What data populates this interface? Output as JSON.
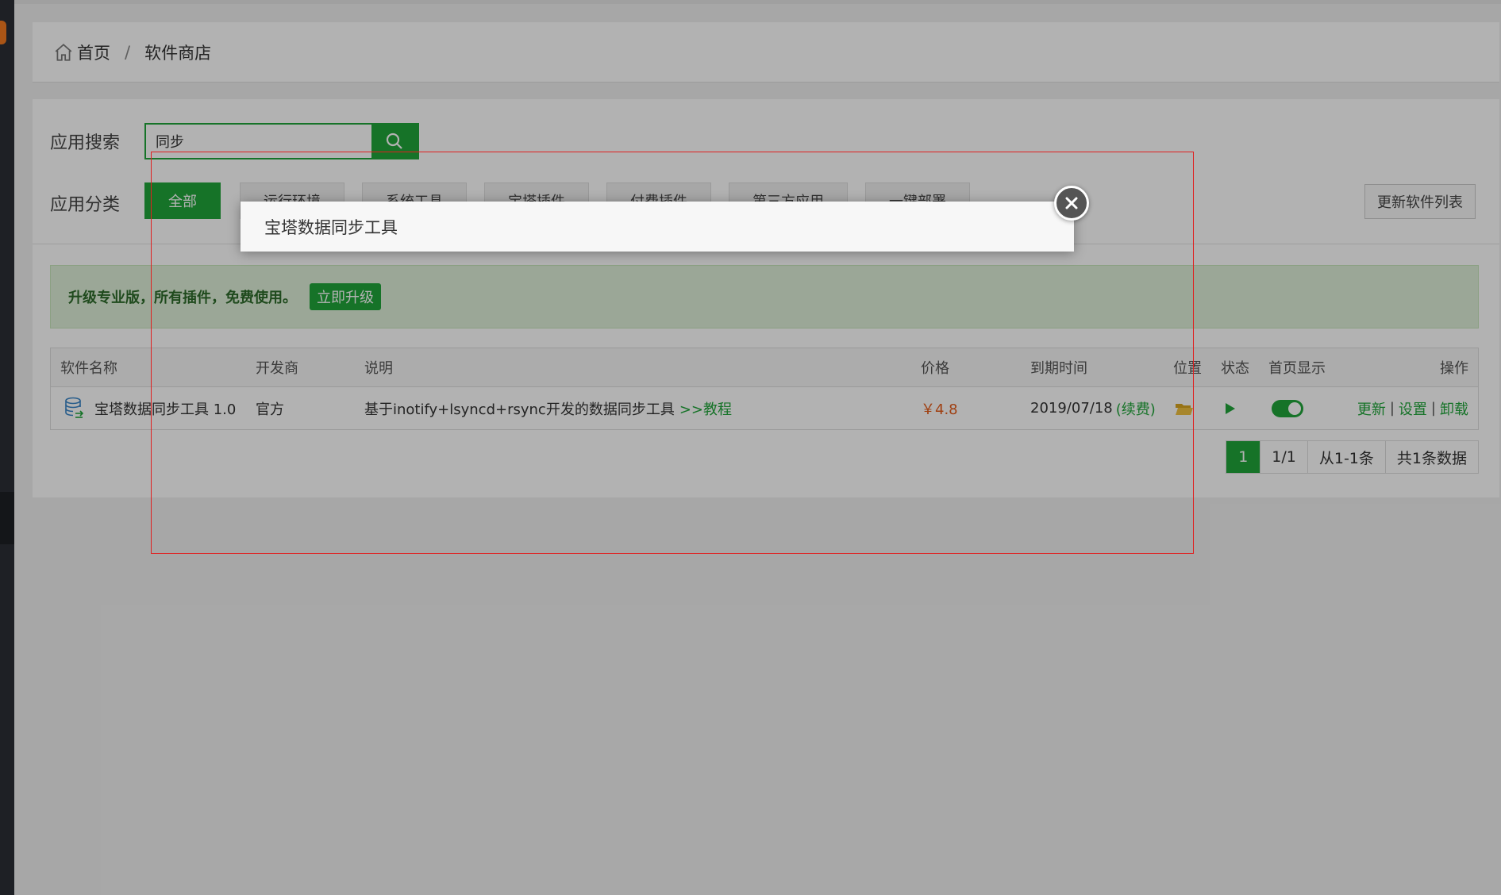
{
  "breadcrumb": {
    "home": "首页",
    "separator": "/",
    "current": "软件商店"
  },
  "search": {
    "label": "应用搜索",
    "value": "同步"
  },
  "categories": {
    "label": "应用分类",
    "items": [
      "全部",
      "运行环境",
      "系统工具",
      "宝塔插件",
      "付费插件",
      "第三方应用",
      "一键部署"
    ],
    "active": "全部",
    "refresh_label": "更新软件列表"
  },
  "promo": {
    "text": "升级专业版，所有插件，免费使用。",
    "button": "立即升级"
  },
  "table": {
    "headers": [
      "软件名称",
      "开发商",
      "说明",
      "价格",
      "到期时间",
      "位置",
      "状态",
      "首页显示",
      "操作"
    ],
    "rows": [
      {
        "name": "宝塔数据同步工具 1.0",
        "developer": "官方",
        "description": "基于inotify+lsyncd+rsync开发的数据同步工具",
        "tutorial_link": ">>教程",
        "price": "￥4.8",
        "expiry": "2019/07/18",
        "renew": "(续费)",
        "actions": {
          "update": "更新",
          "settings": "设置",
          "uninstall": "卸载",
          "sep": "|"
        }
      }
    ]
  },
  "pager": {
    "current": "1",
    "pages": "1/1",
    "range": "从1-1条",
    "total": "共1条数据"
  },
  "dialog": {
    "title": "宝塔数据同步工具"
  },
  "colors": {
    "accent": "#20a53a",
    "price": "#e55c1a",
    "frame": "#e02020"
  }
}
